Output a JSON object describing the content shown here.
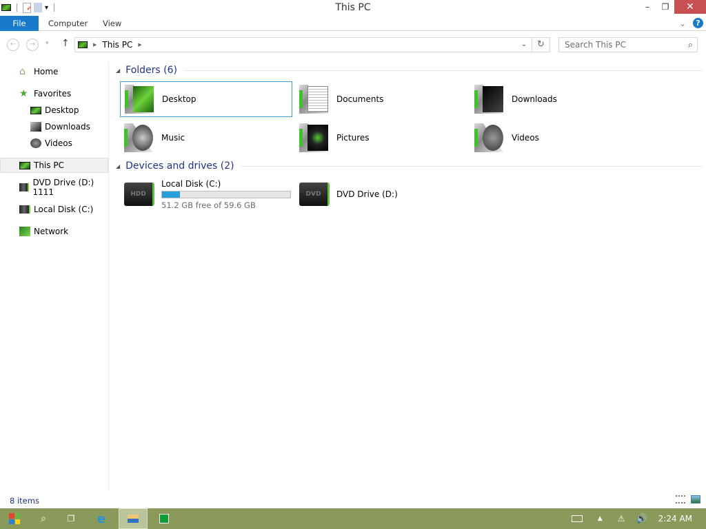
{
  "window": {
    "title": "This PC",
    "minimize": "–",
    "restore": "❐",
    "close": "✕"
  },
  "qat": {
    "dropdown": "▾"
  },
  "ribbon": {
    "tabs": [
      "File",
      "Computer",
      "View"
    ],
    "expand": "⌄",
    "help": "?"
  },
  "nav": {
    "back": "←",
    "forward": "→",
    "recent": "▾",
    "up": "↑",
    "address": "This PC",
    "address_dd": "⌄",
    "refresh": "↻",
    "search_placeholder": "Search This PC",
    "search_icon": "⌕"
  },
  "sidebar": {
    "items": [
      {
        "label": "Home",
        "icon": "home-icon"
      },
      {
        "label": "Favorites",
        "icon": "star-icon"
      },
      {
        "label": "Desktop",
        "icon": "desktop-icon"
      },
      {
        "label": "Downloads",
        "icon": "downloads-icon"
      },
      {
        "label": "Videos",
        "icon": "videos-icon"
      },
      {
        "label": "This PC",
        "icon": "pc-icon"
      },
      {
        "label": "DVD Drive (D:) 1111",
        "icon": "dvd-icon"
      },
      {
        "label": "Local Disk (C:)",
        "icon": "disk-icon"
      },
      {
        "label": "Network",
        "icon": "network-icon"
      }
    ]
  },
  "folders": {
    "header": "Folders (6)",
    "items": [
      "Desktop",
      "Documents",
      "Downloads",
      "Music",
      "Pictures",
      "Videos"
    ]
  },
  "drives": {
    "header": "Devices and drives (2)",
    "items": [
      {
        "name": "Local Disk (C:)",
        "label": "HDD",
        "free": "51.2 GB free of 59.6 GB",
        "used_fraction": 0.14
      },
      {
        "name": "DVD Drive (D:)",
        "label": "DVD"
      }
    ]
  },
  "status": {
    "count": "8 items"
  },
  "taskbar": {
    "clock": "2:24 AM"
  },
  "colors": {
    "accent": "#1979ca",
    "taskbar": "#8a9a5b",
    "close": "#c75050",
    "progress": "#26a0da"
  }
}
